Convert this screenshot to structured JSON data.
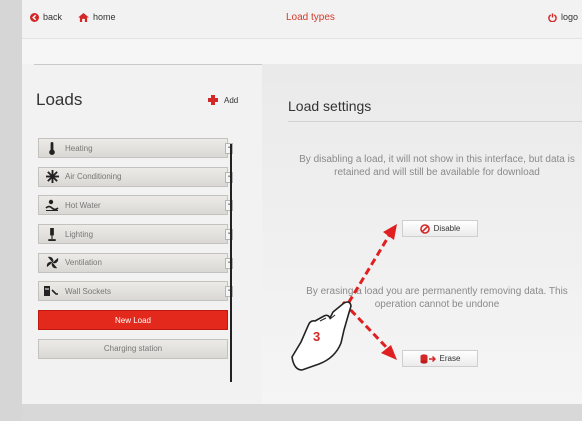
{
  "topbar": {
    "back_label": "back",
    "home_label": "home",
    "title": "Load types",
    "logout_label": "logo"
  },
  "loads": {
    "title": "Loads",
    "add_label": "Add",
    "items": [
      {
        "label": "Heating",
        "icon": "thermometer-icon"
      },
      {
        "label": "Air Conditioning",
        "icon": "snowflake-icon"
      },
      {
        "label": "Hot Water",
        "icon": "hot-water-icon"
      },
      {
        "label": "Lighting",
        "icon": "lamp-icon"
      },
      {
        "label": "Ventilation",
        "icon": "fan-icon"
      },
      {
        "label": "Wall Sockets",
        "icon": "plug-icon"
      }
    ],
    "new_load_label": "New Load",
    "charging_label": "Charging station"
  },
  "settings": {
    "title": "Load settings",
    "disable_text": "By disabling a load, it will not show in this interface, but data is retained and will still be available for download",
    "disable_label": "Disable",
    "erase_text": "By erasing a load you are permanently removing data. This operation cannot be undone",
    "erase_label": "Erase"
  },
  "annotation": {
    "step_number": "3"
  },
  "colors": {
    "accent": "#e3281c",
    "arrow": "#e02020"
  }
}
